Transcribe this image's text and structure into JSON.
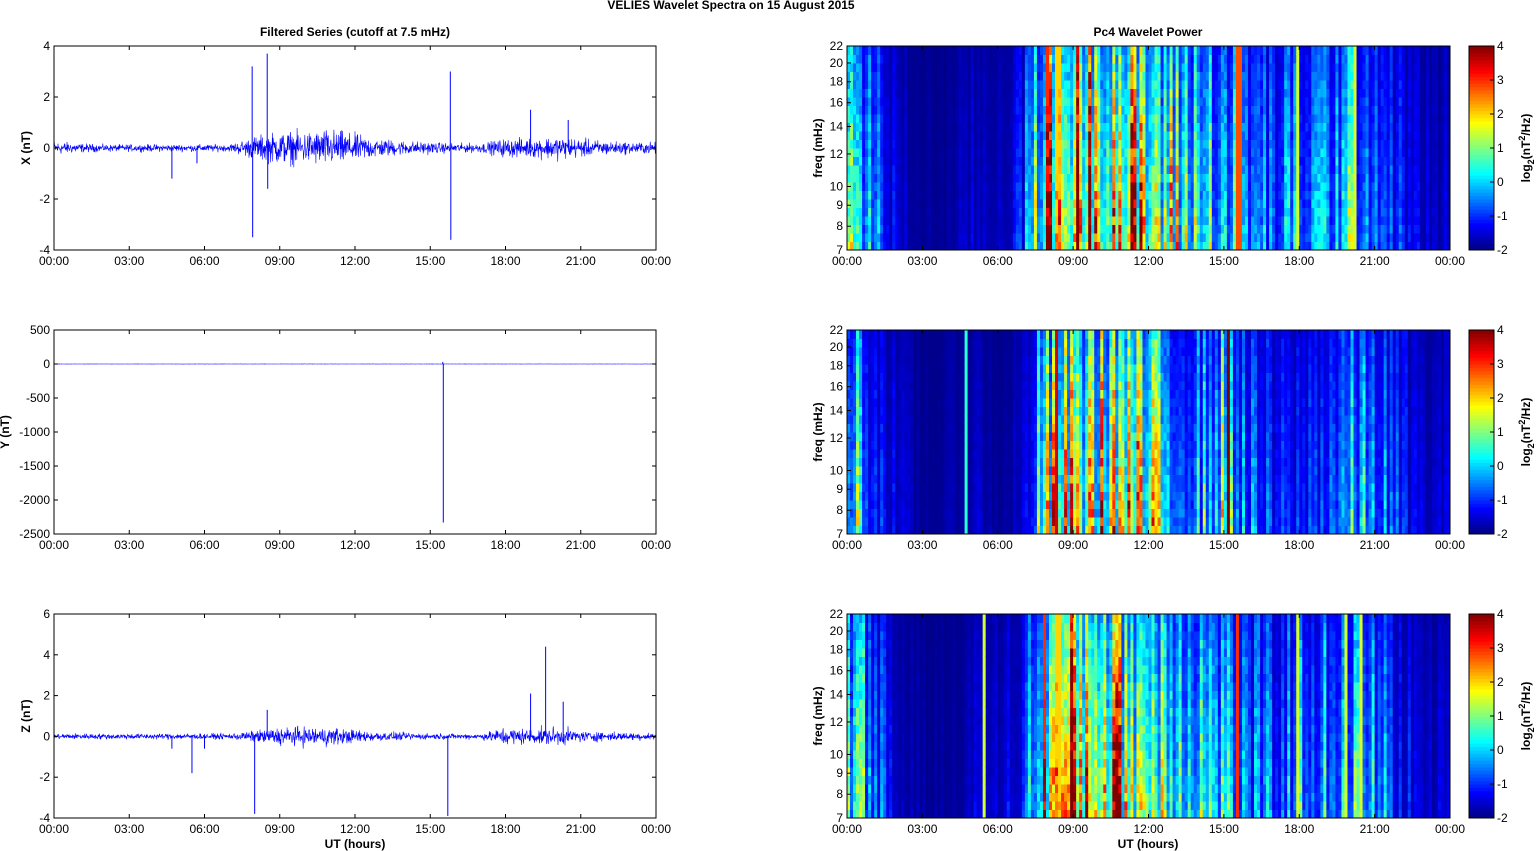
{
  "figure_title": "VELIES Wavelet Spectra on 15 August    2015",
  "left_title": "Filtered Series (cutoff at 7.5 mHz)",
  "right_title": "Pc4 Wavelet Power",
  "xlabel": "UT (hours)",
  "x_ticks": [
    "00:00",
    "03:00",
    "06:00",
    "09:00",
    "12:00",
    "15:00",
    "18:00",
    "21:00",
    "00:00"
  ],
  "colorbar": {
    "label": "log2(nT^2/Hz)",
    "ticks": [
      "-2",
      "-1",
      "0",
      "1",
      "2",
      "3",
      "4"
    ],
    "range": [
      -2,
      4
    ],
    "colormap": "jet"
  },
  "chart_data": [
    {
      "type": "line",
      "name": "X",
      "ylabel": "X (nT)",
      "ylim": [
        -4,
        4
      ],
      "yticks": [
        "-4",
        "-2",
        "0",
        "2",
        "4"
      ],
      "color": "#0000ff",
      "envelope_by_hour": [
        0.3,
        0.2,
        0.15,
        0.15,
        0.15,
        0.15,
        0.15,
        0.15,
        0.5,
        0.7,
        0.7,
        0.8,
        0.6,
        0.4,
        0.3,
        0.25,
        0.2,
        0.2,
        0.4,
        0.4,
        0.5,
        0.4,
        0.3,
        0.25
      ],
      "spikes": [
        {
          "t": 4.7,
          "v": -1.2
        },
        {
          "t": 5.7,
          "v": -0.6
        },
        {
          "t": 7.9,
          "v": 3.2
        },
        {
          "t": 7.92,
          "v": -3.5
        },
        {
          "t": 8.5,
          "v": 3.7
        },
        {
          "t": 8.52,
          "v": -1.6
        },
        {
          "t": 15.8,
          "v": 3.0
        },
        {
          "t": 15.82,
          "v": -3.6
        },
        {
          "t": 19.0,
          "v": 1.5
        },
        {
          "t": 20.5,
          "v": 1.1
        }
      ]
    },
    {
      "type": "line",
      "name": "Y",
      "ylabel": "Y (nT)",
      "ylim": [
        -2500,
        500
      ],
      "yticks": [
        "-2500",
        "-2000",
        "-1500",
        "-1000",
        "-500",
        "0",
        "500"
      ],
      "color": "#0000ff",
      "envelope_by_hour": [
        2,
        2,
        2,
        2,
        2,
        2,
        2,
        2,
        2,
        2,
        2,
        2,
        2,
        2,
        2,
        2,
        2,
        2,
        2,
        2,
        2,
        2,
        2,
        2
      ],
      "spikes": [
        {
          "t": 15.5,
          "v": 30
        },
        {
          "t": 15.52,
          "v": -2330
        }
      ]
    },
    {
      "type": "line",
      "name": "Z",
      "ylabel": "Z (nT)",
      "ylim": [
        -4,
        6
      ],
      "yticks": [
        "-4",
        "-2",
        "0",
        "2",
        "4",
        "6"
      ],
      "color": "#0000ff",
      "envelope_by_hour": [
        0.15,
        0.15,
        0.15,
        0.15,
        0.15,
        0.15,
        0.15,
        0.15,
        0.3,
        0.5,
        0.5,
        0.5,
        0.35,
        0.25,
        0.2,
        0.15,
        0.15,
        0.15,
        0.5,
        0.4,
        0.5,
        0.3,
        0.25,
        0.2
      ],
      "spikes": [
        {
          "t": 4.7,
          "v": -0.6
        },
        {
          "t": 5.5,
          "v": -1.8
        },
        {
          "t": 6.0,
          "v": -0.6
        },
        {
          "t": 8.0,
          "v": -3.8
        },
        {
          "t": 8.5,
          "v": 1.3
        },
        {
          "t": 15.7,
          "v": -3.9
        },
        {
          "t": 19.0,
          "v": 2.1
        },
        {
          "t": 19.6,
          "v": 4.4
        },
        {
          "t": 20.3,
          "v": 1.7
        }
      ]
    },
    {
      "type": "heatmap",
      "name": "X wavelet",
      "ylabel": "freq (mHz)",
      "ylim": [
        7,
        22
      ],
      "yscale": "log",
      "yticks": [
        "7",
        "8",
        "9",
        "10",
        "12",
        "14",
        "16",
        "18",
        "20",
        "22"
      ],
      "power_by_hour": [
        1.5,
        0,
        -1.5,
        -1.8,
        -1.8,
        -1.5,
        -1.5,
        -1,
        3,
        3.5,
        3.5,
        3,
        2,
        1.5,
        1,
        0.5,
        0,
        -0.5,
        0,
        0,
        0.5,
        0,
        -1,
        -1.5
      ],
      "lines": [
        {
          "t": 7.95,
          "v": 3
        },
        {
          "t": 8.4,
          "v": 2
        },
        {
          "t": 15.6,
          "v": 2.8
        },
        {
          "t": 17.9,
          "v": 1.5
        },
        {
          "t": 20.2,
          "v": 1.5
        }
      ]
    },
    {
      "type": "heatmap",
      "name": "Y wavelet",
      "ylabel": "freq (mHz)",
      "ylim": [
        7,
        22
      ],
      "yscale": "log",
      "yticks": [
        "7",
        "8",
        "9",
        "10",
        "12",
        "14",
        "16",
        "18",
        "20",
        "22"
      ],
      "power_by_hour": [
        1.5,
        -0.5,
        -1.5,
        -1.8,
        -1.8,
        -1.5,
        -1.8,
        -1.5,
        1.5,
        2,
        2,
        2.5,
        1.5,
        0.5,
        0,
        1,
        -0.5,
        -1,
        -1,
        -0.5,
        0,
        0,
        -1,
        -1.5
      ],
      "lines": [
        {
          "t": 4.7,
          "v": 0.5
        },
        {
          "t": 8.3,
          "v": 3.5
        },
        {
          "t": 15.2,
          "v": 4
        }
      ]
    },
    {
      "type": "heatmap",
      "name": "Z wavelet",
      "ylabel": "freq (mHz)",
      "ylim": [
        7,
        22
      ],
      "yscale": "log",
      "yticks": [
        "7",
        "8",
        "9",
        "10",
        "12",
        "14",
        "16",
        "18",
        "20",
        "22"
      ],
      "power_by_hour": [
        1.5,
        0,
        -1.5,
        -1.8,
        -1.8,
        -1.5,
        -1.5,
        -1,
        3,
        3.5,
        3.5,
        2.5,
        2,
        1.5,
        1,
        0.5,
        -0.5,
        -0.5,
        0,
        0,
        0.5,
        0,
        -1,
        -1.5
      ],
      "lines": [
        {
          "t": 5.5,
          "v": 1.5
        },
        {
          "t": 7.9,
          "v": 3
        },
        {
          "t": 8.4,
          "v": 2
        },
        {
          "t": 15.5,
          "v": 3
        },
        {
          "t": 17.9,
          "v": 1.5
        },
        {
          "t": 19.9,
          "v": 1.5
        },
        {
          "t": 20.5,
          "v": 1.5
        }
      ]
    }
  ]
}
